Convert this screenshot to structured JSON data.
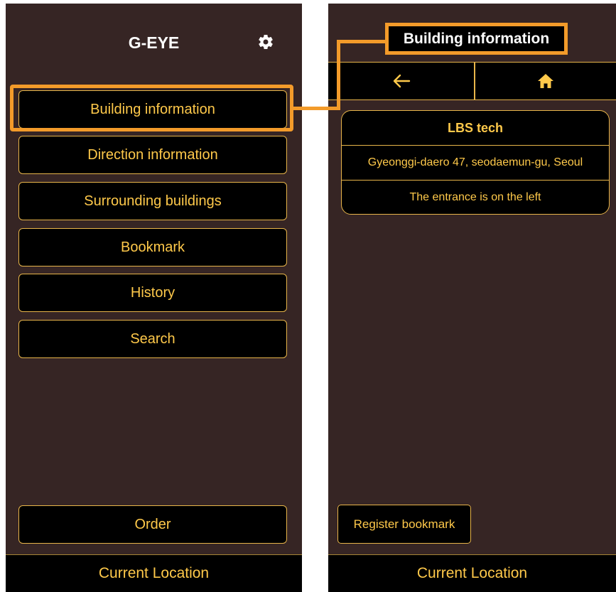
{
  "left_screen": {
    "title": "G-EYE",
    "settings_icon": "gear-icon",
    "menu": [
      {
        "label": "Building information"
      },
      {
        "label": "Direction information"
      },
      {
        "label": "Surrounding buildings"
      },
      {
        "label": "Bookmark"
      },
      {
        "label": "History"
      },
      {
        "label": "Search"
      }
    ],
    "order_label": "Order",
    "current_location_label": "Current Location"
  },
  "right_screen": {
    "header_title": "Building information",
    "nav": {
      "back_icon": "arrow-left-icon",
      "home_icon": "home-icon"
    },
    "building": {
      "name": "LBS tech",
      "address": "Gyeonggi-daero 47, seodaemun-gu, Seoul",
      "entrance_note": "The entrance is on the left"
    },
    "register_bookmark_label": "Register bookmark",
    "current_location_label": "Current Location"
  },
  "colors": {
    "background": "#362524",
    "accent": "#ffc94a",
    "border": "#e8b54a",
    "highlight": "#f39b2a"
  }
}
